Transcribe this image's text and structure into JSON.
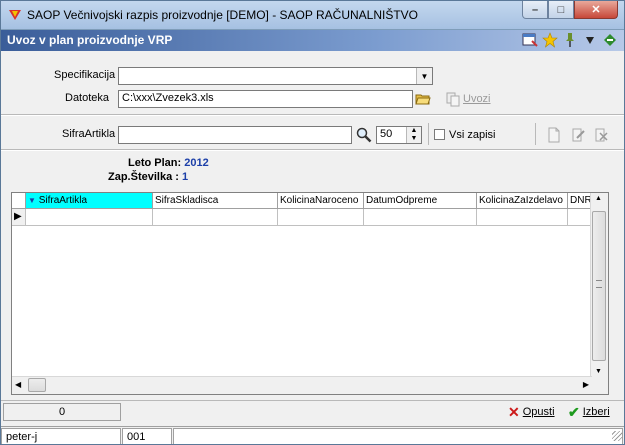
{
  "window": {
    "title": "SAOP Večnivojski razpis proizvodnje [DEMO] - SAOP RAČUNALNIŠTVO"
  },
  "header": {
    "title": "Uvoz v plan proizvodnje VRP"
  },
  "form": {
    "specifikacija_label": "Specifikacija",
    "specifikacija_value": "",
    "datoteka_label": "Datoteka",
    "datoteka_value": "C:\\xxx\\Zvezek3.xls",
    "uvozi_label": "Uvozi",
    "sifra_label": "SifraArtikla",
    "sifra_value": "",
    "count_value": "50",
    "vsi_zapisi_label": "Vsi zapisi"
  },
  "info": {
    "leto_label": "Leto Plan:",
    "leto_value": "2012",
    "zap_label": "Zap.Številka :",
    "zap_value": "1"
  },
  "grid": {
    "columns": [
      "SifraArtikla",
      "SifraSkladisca",
      "KolicinaNaroceno",
      "DatumOdpreme",
      "KolicinaZaIzdelavo",
      "DNRokI"
    ]
  },
  "footer": {
    "count": "0",
    "cancel_label": "Opusti",
    "select_label": "Izberi",
    "user": "peter-j",
    "code": "001"
  }
}
